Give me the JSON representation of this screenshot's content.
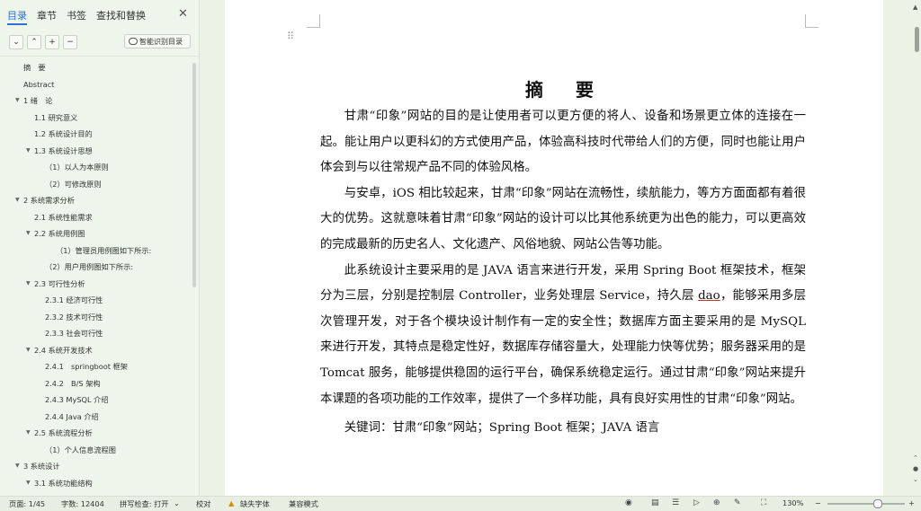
{
  "nav": {
    "tabs": [
      "目录",
      "章节",
      "书签",
      "查找和替换"
    ],
    "close": "✕",
    "tools": {
      "collapse": "⌄",
      "expand": "⌃",
      "add": "+",
      "remove": "−"
    },
    "smart_toc": "智能识别目录",
    "toc": [
      {
        "label": "摘　要",
        "level": 0,
        "arrow": ""
      },
      {
        "label": "Abstract",
        "level": 0,
        "arrow": ""
      },
      {
        "label": "1 绪　论",
        "level": 0,
        "arrow": "▼"
      },
      {
        "label": "1.1 研究意义",
        "level": 1,
        "arrow": ""
      },
      {
        "label": "1.2 系统设计目的",
        "level": 1,
        "arrow": ""
      },
      {
        "label": "1.3 系统设计思想",
        "level": 1,
        "arrow": "▼"
      },
      {
        "label": "（1）以人为本原则",
        "level": 2,
        "arrow": ""
      },
      {
        "label": "（2）可修改原则",
        "level": 2,
        "arrow": ""
      },
      {
        "label": "2 系统需求分析",
        "level": 0,
        "arrow": "▼"
      },
      {
        "label": "2.1 系统性能需求",
        "level": 1,
        "arrow": ""
      },
      {
        "label": "2.2 系统用例图",
        "level": 1,
        "arrow": "▼"
      },
      {
        "label": "（1）管理员用例图如下所示:",
        "level": 3,
        "arrow": ""
      },
      {
        "label": "（2）用户用例图如下所示:",
        "level": 2,
        "arrow": ""
      },
      {
        "label": "2.3 可行性分析",
        "level": 1,
        "arrow": "▼"
      },
      {
        "label": "2.3.1 经济可行性",
        "level": 2,
        "arrow": ""
      },
      {
        "label": "2.3.2 技术可行性",
        "level": 2,
        "arrow": ""
      },
      {
        "label": "2.3.3 社会可行性",
        "level": 2,
        "arrow": ""
      },
      {
        "label": "2.4 系统开发技术",
        "level": 1,
        "arrow": "▼"
      },
      {
        "label": "2.4.1　springboot 框架",
        "level": 2,
        "arrow": ""
      },
      {
        "label": "2.4.2　B/S 架构",
        "level": 2,
        "arrow": ""
      },
      {
        "label": "2.4.3 MySQL 介绍",
        "level": 2,
        "arrow": ""
      },
      {
        "label": "2.4.4 Java 介绍",
        "level": 2,
        "arrow": ""
      },
      {
        "label": "2.5 系统流程分析",
        "level": 1,
        "arrow": "▼"
      },
      {
        "label": "（1）个人信息流程图",
        "level": 2,
        "arrow": ""
      },
      {
        "label": "3 系统设计",
        "level": 0,
        "arrow": "▼"
      },
      {
        "label": "3.1 系统功能结构",
        "level": 1,
        "arrow": "▼"
      }
    ]
  },
  "doc": {
    "title": "摘　要",
    "para1": "甘肃“印象”网站的目的是让使用者可以更方便的将人、设备和场景更立体的连接在一起。能让用户以更科幻的方式使用产品，体验高科技时代带给人们的方便，同时也能让用户体会到与以往常规产品不同的体验风格。",
    "para2": "与安卓，iOS 相比较起来，甘肃“印象”网站在流畅性，续航能力，等方方面面都有着很大的优势。这就意味着甘肃“印象”网站的设计可以比其他系统更为出色的能力，可以更高效的完成最新的历史名人、文化遗产、风俗地貌、网站公告等功能。",
    "para3a": "此系统设计主要采用的是 JAVA 语言来进行开发，采用 Spring Boot 框架技术，框架分为三层，分别是控制层 Controller，业务处理层 Service，持久层 ",
    "para3_ul": "dao",
    "para3b": "，能够采用多层次管理开发，对于各个模块设计制作有一定的安全性；数据库方面主要采用的是 MySQL 来进行开发，其特点是稳定性好，数据库存储容量大，处理能力快等优势；服务器采用的是 Tomcat 服务，能够提供稳固的运行平台，确保系统稳定运行。通过甘肃“印象”网站来提升本课题的各项功能的工作效率，提供了一个多样功能，具有良好实用性的甘肃“印象”网站。",
    "keywords_label": "关键词：",
    "keywords": "甘肃“印象”网站；Spring Boot 框架；JAVA 语言"
  },
  "status": {
    "page": "页面: 1/45",
    "words": "字数: 12404",
    "spell": "拼写检查: 打开",
    "spell_caret": "⌄",
    "proof": "校对",
    "missing_font": "缺失字体",
    "compat": "兼容模式",
    "zoom": "130%",
    "zoom_minus": "−",
    "zoom_plus": "+"
  }
}
